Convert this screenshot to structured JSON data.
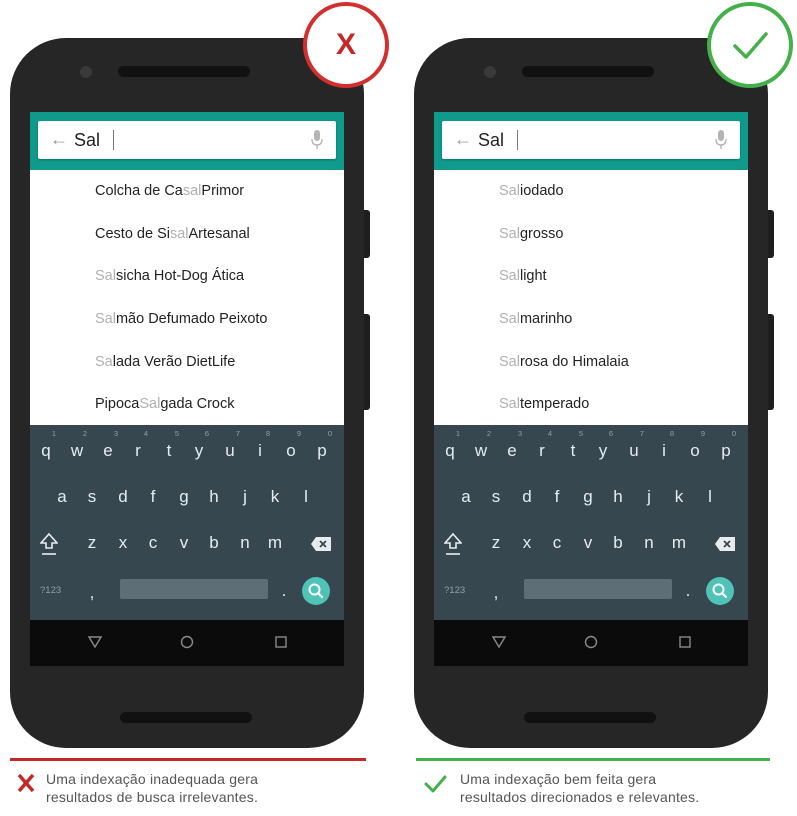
{
  "bad_example": {
    "badge_label": "X",
    "badge_color": "#d32f2f",
    "search": {
      "query": "Sal"
    },
    "suggestions": [
      {
        "before": "Colcha de Ca",
        "match": "sal",
        "after": " Primor"
      },
      {
        "before": "Cesto de Si",
        "match": "sal",
        "after": " Artesanal"
      },
      {
        "before": "",
        "match": "Sal",
        "after": "sicha Hot-Dog Ática"
      },
      {
        "before": "",
        "match": "Sal",
        "after": "mão Defumado Peixoto"
      },
      {
        "before": "",
        "match": "Sa",
        "after": "lada Verão DietLife"
      },
      {
        "before": "Pipoca ",
        "match": "Sal",
        "after": "gada Crock"
      }
    ],
    "caption_line1": "Uma indexação inadequada gera",
    "caption_line2": "resultados de busca irrelevantes."
  },
  "good_example": {
    "badge_icon": "checkmark-icon",
    "badge_color": "#43b049",
    "search": {
      "query": "Sal"
    },
    "suggestions": [
      {
        "before": "",
        "match": "Sal",
        "after": " iodado"
      },
      {
        "before": "",
        "match": "Sal",
        "after": " grosso"
      },
      {
        "before": "",
        "match": "Sal",
        "after": " light"
      },
      {
        "before": "",
        "match": "Sal",
        "after": " marinho"
      },
      {
        "before": "",
        "match": "Sal",
        "after": " rosa do Himalaia"
      },
      {
        "before": "",
        "match": "Sal",
        "after": " temperado"
      }
    ],
    "caption_line1": "Uma indexação bem feita gera",
    "caption_line2": "resultados direcionados e relevantes."
  },
  "keyboard": {
    "row1": [
      "q",
      "w",
      "e",
      "r",
      "t",
      "y",
      "u",
      "i",
      "o",
      "p"
    ],
    "row1_numbers": [
      "1",
      "2",
      "3",
      "4",
      "5",
      "6",
      "7",
      "8",
      "9",
      "0"
    ],
    "row2": [
      "a",
      "s",
      "d",
      "f",
      "g",
      "h",
      "j",
      "k",
      "l"
    ],
    "row3": [
      "z",
      "x",
      "c",
      "v",
      "b",
      "n",
      "m"
    ],
    "symbols_key": "?123",
    "comma_key": ",",
    "period_key": "."
  },
  "colors": {
    "accent": "#109a8b",
    "keyboard_bg": "#37474f",
    "search_key": "#4fc3b8",
    "highlight_text": "#b0b0b0"
  }
}
